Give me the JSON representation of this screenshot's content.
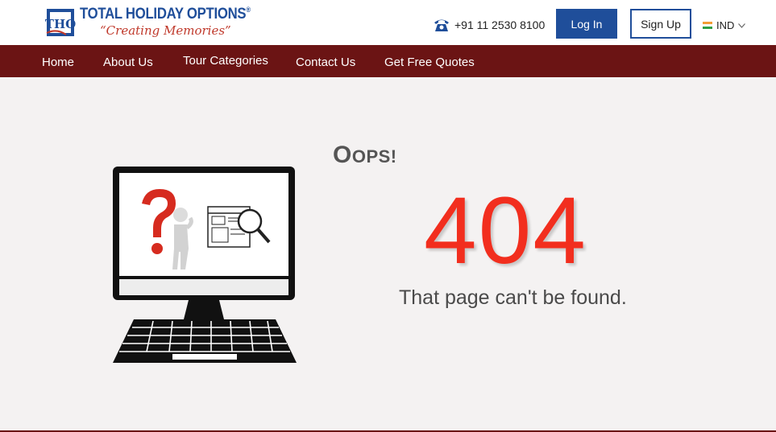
{
  "header": {
    "logo": {
      "mark_text": "THO",
      "title": "TOTAL HOLIDAY OPTIONS",
      "registered": "®",
      "tagline": "“Creating Memories”"
    },
    "phone": {
      "icon": "telephone-icon",
      "number": "+91 11 2530 8100"
    },
    "login_label": "Log In",
    "signup_label": "Sign Up",
    "country": {
      "flag": "india-flag-icon",
      "code": "IND"
    }
  },
  "nav": {
    "items": [
      {
        "label": "Home"
      },
      {
        "label": "About Us"
      },
      {
        "label": "Tour Categories"
      },
      {
        "label": "Contact Us"
      },
      {
        "label": "Get Free Quotes"
      }
    ]
  },
  "error": {
    "illustration": "computer-question-mark-illustration",
    "oops_first": "O",
    "oops_rest": "OPS!",
    "code": "404",
    "message": "That page can't be found."
  },
  "colors": {
    "brand_blue": "#1f4e9a",
    "nav_maroon": "#6b1414",
    "error_red": "#f22e1e",
    "tagline_red": "#c0392b"
  }
}
